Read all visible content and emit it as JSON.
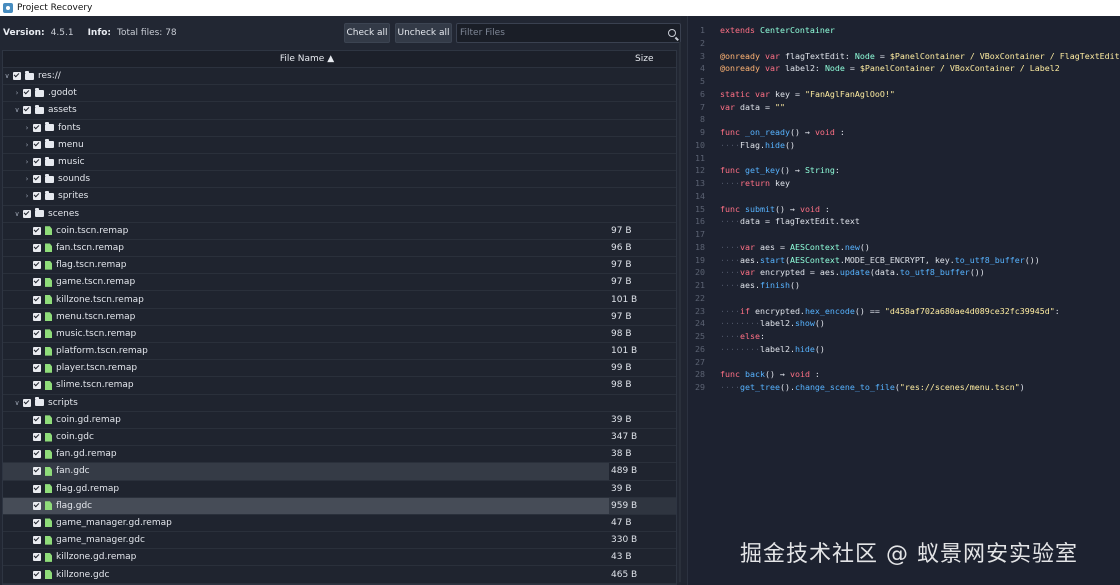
{
  "window": {
    "title": "Project Recovery",
    "icon": "godot-icon"
  },
  "toolbar": {
    "version_label": "Version:",
    "version_value": "4.5.1",
    "info_label": "Info:",
    "info_value": "Total files: 78",
    "check_all": "Check all",
    "uncheck_all": "Uncheck all",
    "filter_placeholder": "Filter Files"
  },
  "tree": {
    "header_name": "File Name ▲",
    "header_size": "Size",
    "rows": [
      {
        "name": "res://",
        "size": "",
        "type": "folder",
        "depth": 0,
        "expanded": true
      },
      {
        "name": ".godot",
        "size": "",
        "type": "folder",
        "depth": 1,
        "expanded": false
      },
      {
        "name": "assets",
        "size": "",
        "type": "folder",
        "depth": 1,
        "expanded": true
      },
      {
        "name": "fonts",
        "size": "",
        "type": "folder",
        "depth": 2,
        "expanded": false
      },
      {
        "name": "menu",
        "size": "",
        "type": "folder",
        "depth": 2,
        "expanded": false
      },
      {
        "name": "music",
        "size": "",
        "type": "folder",
        "depth": 2,
        "expanded": false
      },
      {
        "name": "sounds",
        "size": "",
        "type": "folder",
        "depth": 2,
        "expanded": false
      },
      {
        "name": "sprites",
        "size": "",
        "type": "folder",
        "depth": 2,
        "expanded": false
      },
      {
        "name": "scenes",
        "size": "",
        "type": "folder",
        "depth": 1,
        "expanded": true
      },
      {
        "name": "coin.tscn.remap",
        "size": "97 B",
        "type": "file",
        "depth": 2
      },
      {
        "name": "fan.tscn.remap",
        "size": "96 B",
        "type": "file",
        "depth": 2
      },
      {
        "name": "flag.tscn.remap",
        "size": "97 B",
        "type": "file",
        "depth": 2
      },
      {
        "name": "game.tscn.remap",
        "size": "97 B",
        "type": "file",
        "depth": 2
      },
      {
        "name": "killzone.tscn.remap",
        "size": "101 B",
        "type": "file",
        "depth": 2
      },
      {
        "name": "menu.tscn.remap",
        "size": "97 B",
        "type": "file",
        "depth": 2
      },
      {
        "name": "music.tscn.remap",
        "size": "98 B",
        "type": "file",
        "depth": 2
      },
      {
        "name": "platform.tscn.remap",
        "size": "101 B",
        "type": "file",
        "depth": 2
      },
      {
        "name": "player.tscn.remap",
        "size": "99 B",
        "type": "file",
        "depth": 2
      },
      {
        "name": "slime.tscn.remap",
        "size": "98 B",
        "type": "file",
        "depth": 2
      },
      {
        "name": "scripts",
        "size": "",
        "type": "folder",
        "depth": 1,
        "expanded": true
      },
      {
        "name": "coin.gd.remap",
        "size": "39 B",
        "type": "file",
        "depth": 2
      },
      {
        "name": "coin.gdc",
        "size": "347 B",
        "type": "file",
        "depth": 2
      },
      {
        "name": "fan.gd.remap",
        "size": "38 B",
        "type": "file",
        "depth": 2
      },
      {
        "name": "fan.gdc",
        "size": "489 B",
        "type": "file",
        "depth": 2,
        "state": "hover"
      },
      {
        "name": "flag.gd.remap",
        "size": "39 B",
        "type": "file",
        "depth": 2
      },
      {
        "name": "flag.gdc",
        "size": "959 B",
        "type": "file",
        "depth": 2,
        "state": "selected"
      },
      {
        "name": "game_manager.gd.remap",
        "size": "47 B",
        "type": "file",
        "depth": 2
      },
      {
        "name": "game_manager.gdc",
        "size": "330 B",
        "type": "file",
        "depth": 2
      },
      {
        "name": "killzone.gd.remap",
        "size": "43 B",
        "type": "file",
        "depth": 2
      },
      {
        "name": "killzone.gdc",
        "size": "465 B",
        "type": "file",
        "depth": 2
      }
    ]
  },
  "code": {
    "lines": [
      [
        {
          "t": "extends",
          "c": "kw"
        },
        {
          "t": " "
        },
        {
          "t": "CenterContainer",
          "c": "ty"
        }
      ],
      [],
      [
        {
          "t": "@onready",
          "c": "an"
        },
        {
          "t": " "
        },
        {
          "t": "var",
          "c": "kw"
        },
        {
          "t": " flagTextEdit: "
        },
        {
          "t": "Node",
          "c": "ty"
        },
        {
          "t": " = "
        },
        {
          "t": "$PanelContainer / VBoxContainer / FlagTextEdit",
          "c": "st"
        }
      ],
      [
        {
          "t": "@onready",
          "c": "an"
        },
        {
          "t": " "
        },
        {
          "t": "var",
          "c": "kw"
        },
        {
          "t": " label2: "
        },
        {
          "t": "Node",
          "c": "ty"
        },
        {
          "t": " = "
        },
        {
          "t": "$PanelContainer / VBoxContainer / Label2",
          "c": "st"
        }
      ],
      [],
      [
        {
          "t": "static",
          "c": "kw"
        },
        {
          "t": " "
        },
        {
          "t": "var",
          "c": "kw"
        },
        {
          "t": " key = "
        },
        {
          "t": "\"FanAglFanAglOoO!\"",
          "c": "st"
        }
      ],
      [
        {
          "t": "var",
          "c": "kw"
        },
        {
          "t": " data = "
        },
        {
          "t": "\"\"",
          "c": "st"
        }
      ],
      [],
      [
        {
          "t": "func",
          "c": "kw"
        },
        {
          "t": " "
        },
        {
          "t": "_on_ready",
          "c": "fn"
        },
        {
          "t": "() → "
        },
        {
          "t": "void",
          "c": "kw"
        },
        {
          "t": " :"
        }
      ],
      [
        {
          "t": "····",
          "c": "ws"
        },
        {
          "t": "Flag."
        },
        {
          "t": "hide",
          "c": "fn"
        },
        {
          "t": "()"
        }
      ],
      [],
      [
        {
          "t": "func",
          "c": "kw"
        },
        {
          "t": " "
        },
        {
          "t": "get_key",
          "c": "fn"
        },
        {
          "t": "() → "
        },
        {
          "t": "String",
          "c": "ty"
        },
        {
          "t": ":"
        }
      ],
      [
        {
          "t": "····",
          "c": "ws"
        },
        {
          "t": "return",
          "c": "kw"
        },
        {
          "t": " key"
        }
      ],
      [],
      [
        {
          "t": "func",
          "c": "kw"
        },
        {
          "t": " "
        },
        {
          "t": "submit",
          "c": "fn"
        },
        {
          "t": "() → "
        },
        {
          "t": "void",
          "c": "kw"
        },
        {
          "t": " :"
        }
      ],
      [
        {
          "t": "····",
          "c": "ws"
        },
        {
          "t": "data = flagTextEdit.text"
        }
      ],
      [],
      [
        {
          "t": "····",
          "c": "ws"
        },
        {
          "t": "var",
          "c": "kw"
        },
        {
          "t": " aes = "
        },
        {
          "t": "AESContext",
          "c": "ty"
        },
        {
          "t": "."
        },
        {
          "t": "new",
          "c": "fn"
        },
        {
          "t": "()"
        }
      ],
      [
        {
          "t": "····",
          "c": "ws"
        },
        {
          "t": "aes."
        },
        {
          "t": "start",
          "c": "fn"
        },
        {
          "t": "("
        },
        {
          "t": "AESContext",
          "c": "ty"
        },
        {
          "t": ".MODE_ECB_ENCRYPT, key."
        },
        {
          "t": "to_utf8_buffer",
          "c": "fn"
        },
        {
          "t": "())"
        }
      ],
      [
        {
          "t": "····",
          "c": "ws"
        },
        {
          "t": "var",
          "c": "kw"
        },
        {
          "t": " encrypted = aes."
        },
        {
          "t": "update",
          "c": "fn"
        },
        {
          "t": "(data."
        },
        {
          "t": "to_utf8_buffer",
          "c": "fn"
        },
        {
          "t": "())"
        }
      ],
      [
        {
          "t": "····",
          "c": "ws"
        },
        {
          "t": "aes."
        },
        {
          "t": "finish",
          "c": "fn"
        },
        {
          "t": "()"
        }
      ],
      [],
      [
        {
          "t": "····",
          "c": "ws"
        },
        {
          "t": "if",
          "c": "kw"
        },
        {
          "t": " encrypted."
        },
        {
          "t": "hex_encode",
          "c": "fn"
        },
        {
          "t": "() == "
        },
        {
          "t": "\"d458af702a680ae4d089ce32fc39945d\"",
          "c": "st"
        },
        {
          "t": ":"
        }
      ],
      [
        {
          "t": "········",
          "c": "ws"
        },
        {
          "t": "label2."
        },
        {
          "t": "show",
          "c": "fn"
        },
        {
          "t": "()"
        }
      ],
      [
        {
          "t": "····",
          "c": "ws"
        },
        {
          "t": "else",
          "c": "kw"
        },
        {
          "t": ":"
        }
      ],
      [
        {
          "t": "········",
          "c": "ws"
        },
        {
          "t": "label2."
        },
        {
          "t": "hide",
          "c": "fn"
        },
        {
          "t": "()"
        }
      ],
      [],
      [
        {
          "t": "func",
          "c": "kw"
        },
        {
          "t": " "
        },
        {
          "t": "back",
          "c": "fn"
        },
        {
          "t": "() → "
        },
        {
          "t": "void",
          "c": "kw"
        },
        {
          "t": " :"
        }
      ],
      [
        {
          "t": "····",
          "c": "ws"
        },
        {
          "t": "get_tree",
          "c": "fn"
        },
        {
          "t": "()."
        },
        {
          "t": "change_scene_to_file",
          "c": "fn"
        },
        {
          "t": "("
        },
        {
          "t": "\"res://scenes/menu.tscn\"",
          "c": "st"
        },
        {
          "t": ")"
        }
      ]
    ]
  },
  "watermark": "掘金技术社区 @ 蚁景网安实验室"
}
